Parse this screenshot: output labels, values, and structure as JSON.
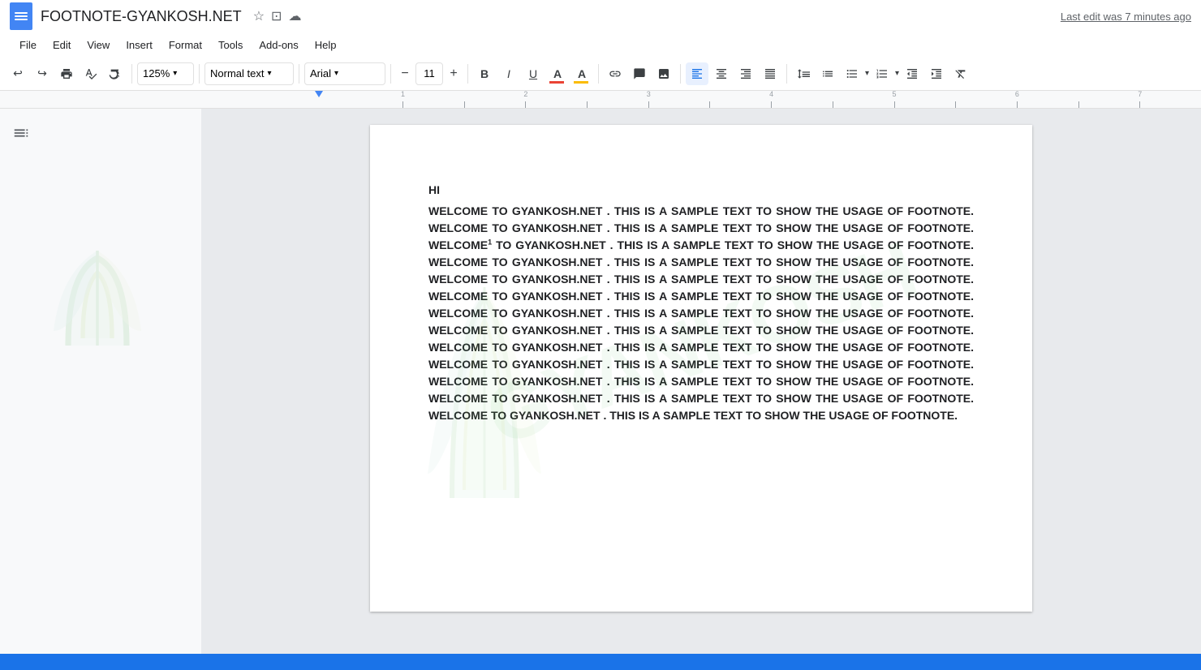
{
  "title_bar": {
    "doc_title": "FOOTNOTE-GYANKOSH.NET",
    "star_icon": "★",
    "save_icon": "⬛",
    "cloud_icon": "☁",
    "last_edit": "Last edit was 7 minutes ago"
  },
  "menu": {
    "items": [
      "File",
      "Edit",
      "View",
      "Insert",
      "Format",
      "Tools",
      "Add-ons",
      "Help"
    ]
  },
  "toolbar": {
    "zoom": "125%",
    "style": "Normal text",
    "font": "Arial",
    "font_size": "11",
    "undo": "↩",
    "redo": "↪",
    "print": "🖨",
    "spellcheck": "A",
    "paint": "🎨",
    "minus": "−",
    "plus": "+",
    "bold": "B",
    "italic": "I",
    "underline": "U",
    "text_color": "A",
    "highlight": "A"
  },
  "document": {
    "heading": "HI",
    "body": "WELCOME TO GYANKOSH.NET . THIS IS A SAMPLE TEXT TO SHOW THE USAGE OF FOOTNOTE. WELCOME TO GYANKOSH.NET . THIS IS A SAMPLE TEXT TO SHOW THE USAGE OF FOOTNOTE. WELCOME TO GYANKOSH.NET . THIS IS A SAMPLE TEXT TO SHOW THE USAGE OF FOOTNOTE. WELCOME TO GYANKOSH.NET . THIS IS A SAMPLE TEXT TO SHOW THE USAGE OF FOOTNOTE. WELCOME TO GYANKOSH.NET . THIS IS A SAMPLE TEXT TO SHOW THE USAGE OF FOOTNOTE. WELCOME TO GYANKOSH.NET . THIS IS A SAMPLE TEXT TO SHOW THE USAGE OF FOOTNOTE. WELCOME TO GYANKOSH.NET . THIS IS A SAMPLE TEXT TO SHOW THE USAGE OF FOOTNOTE. WELCOME TO GYANKOSH.NET . THIS IS A SAMPLE TEXT TO SHOW THE USAGE OF FOOTNOTE. WELCOME TO GYANKOSH.NET . THIS IS A SAMPLE TEXT TO SHOW THE USAGE OF FOOTNOTE. WELCOME TO GYANKOSH.NET . THIS IS A SAMPLE TEXT TO SHOW THE USAGE OF FOOTNOTE. WELCOME TO GYANKOSH.NET . THIS IS A SAMPLE TEXT TO SHOW THE USAGE OF FOOTNOTE. WELCOME TO GYANKOSH.NET . THIS IS A SAMPLE TEXT TO SHOW THE USAGE OF FOOTNOTE. WELCOME TO GYANKOSH.NET . THIS IS A SAMPLE TEXT TO SHOW THE USAGE OF FOOTNOTE.",
    "footnote_marker": "1"
  }
}
